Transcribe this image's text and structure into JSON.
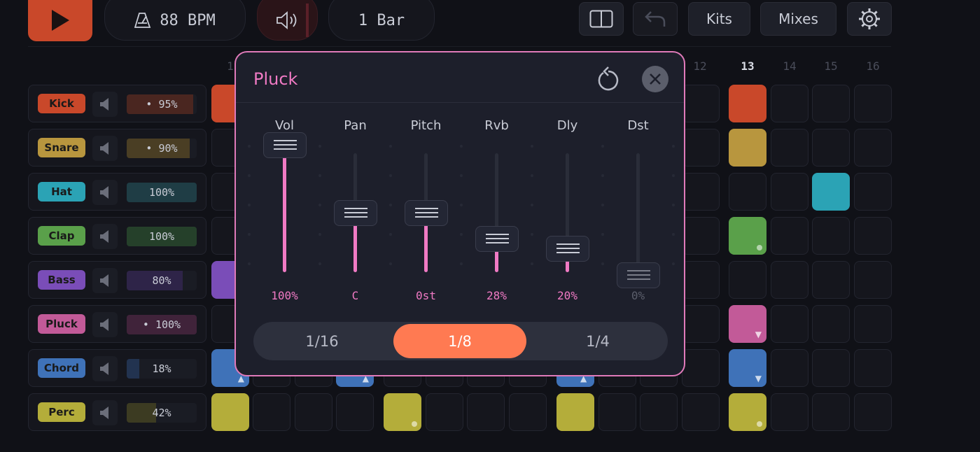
{
  "toolbar": {
    "bpm_label": "88 BPM",
    "bars_label": "1 Bar",
    "kits_label": "Kits",
    "mixes_label": "Mixes"
  },
  "steps": {
    "visible_numbers": [
      "1",
      "12",
      "13",
      "14",
      "15",
      "16"
    ],
    "highlighted": "13"
  },
  "tracks": [
    {
      "name": "Kick",
      "volume": "• 95%",
      "level": 95,
      "color": "#c9482a"
    },
    {
      "name": "Snare",
      "volume": "• 90%",
      "level": 90,
      "color": "#b8963e"
    },
    {
      "name": "Hat",
      "volume": "100%",
      "level": 100,
      "color": "#2ba3b5"
    },
    {
      "name": "Clap",
      "volume": "100%",
      "level": 100,
      "color": "#5aa04a"
    },
    {
      "name": "Bass",
      "volume": "80%",
      "level": 80,
      "color": "#7a4db8"
    },
    {
      "name": "Pluck",
      "volume": "• 100%",
      "level": 100,
      "color": "#c25a98"
    },
    {
      "name": "Chord",
      "volume": "18%",
      "level": 18,
      "color": "#3f72b8"
    },
    {
      "name": "Perc",
      "volume": "42%",
      "level": 42,
      "color": "#b4ad3a"
    }
  ],
  "modal": {
    "title": "Pluck",
    "sliders": [
      {
        "label": "Vol",
        "value": "100%",
        "level": 1.0,
        "dim": false
      },
      {
        "label": "Pan",
        "value": "C",
        "level": 0.5,
        "dim": false
      },
      {
        "label": "Pitch",
        "value": "0st",
        "level": 0.5,
        "dim": false
      },
      {
        "label": "Rvb",
        "value": "28%",
        "level": 0.28,
        "dim": false
      },
      {
        "label": "Dly",
        "value": "20%",
        "level": 0.2,
        "dim": false
      },
      {
        "label": "Dst",
        "value": "0%",
        "level": 0.0,
        "dim": true
      }
    ],
    "note_lengths": [
      "1/16",
      "1/8",
      "1/4"
    ],
    "selected_note_length": "1/8"
  },
  "colors": {
    "accent": "#f07ac4",
    "play": "#c9482a",
    "selected": "#ff7a52"
  }
}
